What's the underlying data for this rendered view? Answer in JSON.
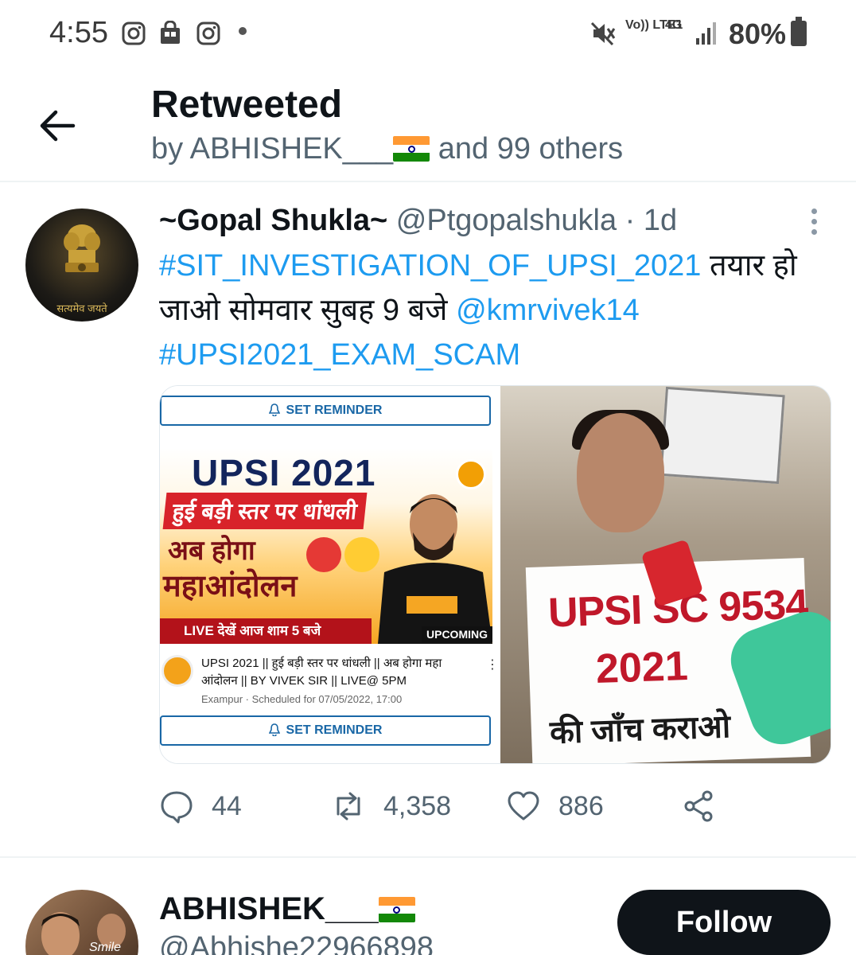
{
  "status_bar": {
    "time": "4:55",
    "network_volte": "Vo)) LTE1",
    "network_type": "4G",
    "battery": "80%"
  },
  "header": {
    "title": "Retweeted",
    "subtitle_prefix": "by ABHISHEK___",
    "subtitle_suffix": "and 99 others"
  },
  "tweet": {
    "author_name": "~Gopal Shukla~",
    "author_handle": "@Ptgopalshukla",
    "time": "· 1d",
    "avatar_caption": "सत्यमेव जयते",
    "text": {
      "hashtag1": "#SIT_INVESTIGATION_OF_UPSI_2021",
      "plain1": " तयार हो जाओ सोमवार सुबह 9 बजे ",
      "mention": "@kmrvivek14",
      "hashtag2": "#UPSI2021_EXAM_SCAM"
    },
    "media_left": {
      "reminder_label": "SET REMINDER",
      "thumb_title": "UPSI 2021",
      "thumb_red": "हुई बड़ी स्तर पर धांधली",
      "thumb_line2": "अब होगा",
      "thumb_line3": "महाआंदोलन",
      "thumb_live": "LIVE देखें आज शाम 5 बजे",
      "thumb_badge": "UPCOMING",
      "video_title": "UPSI 2021 || हुई बड़ी स्तर पर धांधली || अब होगा महा आंदोलन || BY VIVEK SIR || LIVE@ 5PM",
      "video_meta": "Exampur · Scheduled for 07/05/2022, 17:00"
    },
    "media_right": {
      "sign_line1": "UPSI SC  9534",
      "sign_line2": "2021",
      "sign_line3": "की जाँच कराओ"
    },
    "actions": {
      "replies": "44",
      "retweets": "4,358",
      "likes": "886"
    }
  },
  "user_row": {
    "name": "ABHISHEK___",
    "handle": "@Abhishe22966898",
    "avatar_caption": "Smile",
    "follow_label": "Follow"
  }
}
